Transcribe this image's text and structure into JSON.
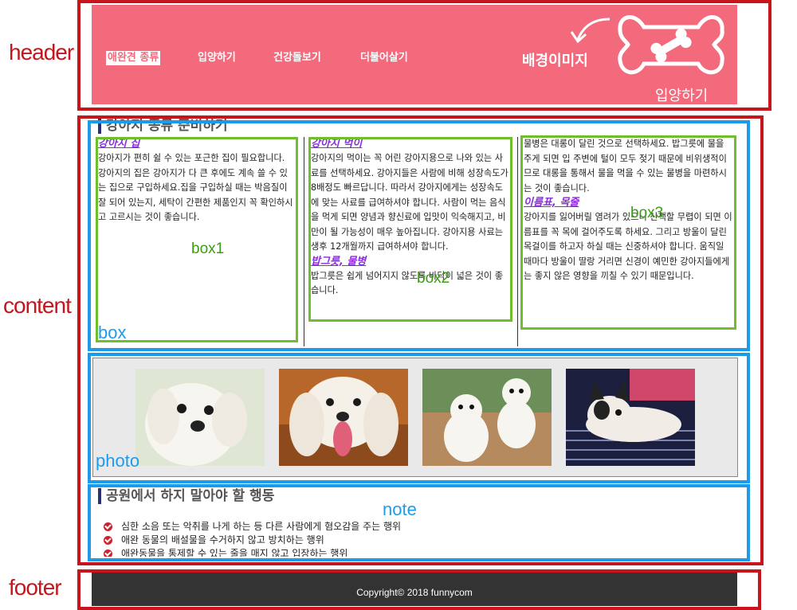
{
  "annotations": {
    "header": "header",
    "content": "content",
    "footer": "footer",
    "box": "box",
    "photo": "photo",
    "note": "note",
    "box1": "box1",
    "box2": "box2",
    "box3": "box3"
  },
  "header": {
    "nav": [
      "애완견 종류",
      "입양하기",
      "건강돌보기",
      "더불어살기"
    ],
    "active_index": 0,
    "bg_label": "배경이미지",
    "bone_label": "입양하기"
  },
  "content": {
    "box_heading": "강아지 종류 준비하기",
    "columns": [
      {
        "sections": [
          {
            "title": "강아지 집",
            "text": "강아지가 편히 쉴 수 있는 포근한 집이 필요합니다. 강아지의 집은 강아지가 다 큰 후에도 계속 쓸 수 있는 집으로 구입하세요.집을 구입하실 때는 박음질이 잘 되어 있는지, 세탁이 간편한 제품인지 꼭 확인하시고 고르시는 것이 좋습니다."
          }
        ]
      },
      {
        "sections": [
          {
            "title": "강아지 먹이",
            "text": "강아지의 먹이는 꼭 어린 강아지용으로 나와 있는 사료를 선택하세요. 강아지들은 사람에 비해 성장속도가 8배정도 빠르답니다. 따라서 강아지에게는 성장속도에 맞는 사료를 급여하셔야 합니다. 사람이 먹는 음식을 먹게 되면 양념과 향신료에 입맛이 익숙해지고, 비만이 될 가능성이 매우 높아집니다. 강아지용 사료는 생후 12개월까지 급여하셔야 합니다."
          },
          {
            "title": "밥그릇, 물병",
            "text": "밥그릇은 쉽게 넘어지지 않도록 바닥이 넓은 것이 좋습니다."
          }
        ]
      },
      {
        "sections": [
          {
            "title": "",
            "text": "물병은 대롱이 달린 것으로 선택하세요. 밥그릇에 물을 주게 되면 입 주변에 털이 모두 젖기 때문에 비위생적이므로 대롱을 통해서 물을 먹을 수 있는 물병을 마련하시는 것이 좋습니다."
          },
          {
            "title": "이름표, 목줄",
            "text": "강아지를 잃어버릴 염려가 있으니 산책할 무렵이 되면 이름표를 꼭 목에 걸어주도록 하세요. 그리고 방울이 달린 목걸이를 하고자 하실 때는 신중하셔야 합니다. 움직일 때마다 방울이 딸랑 거리면 신경이 예민한 강아지들에게는 좋지 않은 영향을 끼칠 수 있기 때문입니다."
          }
        ]
      }
    ],
    "note_heading": "공원에서 하지 말아야 할 행동",
    "note_items": [
      "심한 소음 또는 악취를 나게 하는 등 다른 사람에게 혐오감을 주는 행위",
      "애완 동물의 배설물을 수거하지 않고 방치하는 행위",
      "애완동물을 통제할 수 있는 줄을 매지 않고 입장하는 행위"
    ]
  },
  "photos": [
    "white-puppy-photo",
    "white-dog-tongue-photo",
    "two-white-dogs-photo",
    "french-bulldog-photo"
  ],
  "footer": {
    "copyright": "Copyright© 2018 funnycom"
  },
  "colors": {
    "header_bg": "#f26a7c",
    "footer_bg": "#333333",
    "red_frame": "#c8141b",
    "blue_frame": "#1b9be8",
    "green_frame": "#6fbe2c"
  }
}
